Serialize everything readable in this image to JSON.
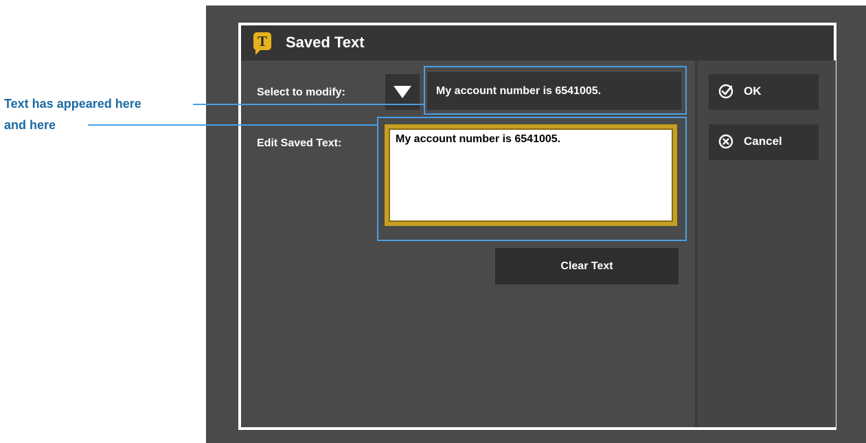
{
  "dialog": {
    "title": "Saved Text",
    "icon_letter": "T",
    "select_label": "Select to modify:",
    "selected_value": "My account number is 6541005.",
    "edit_label": "Edit Saved Text:",
    "edit_value": "My account number is 6541005.",
    "clear_label": "Clear Text",
    "ok_label": "OK",
    "cancel_label": "Cancel"
  },
  "annotation": {
    "line1": "Text has appeared here",
    "line2": "and here"
  },
  "colors": {
    "accent_gold": "#e8b21a",
    "annotation_blue": "#4a9ee6",
    "annotation_text": "#1c6aa3"
  },
  "icons": [
    "saved-text-t-icon",
    "dropdown-triangle-icon",
    "check-circle-icon",
    "x-circle-icon"
  ]
}
